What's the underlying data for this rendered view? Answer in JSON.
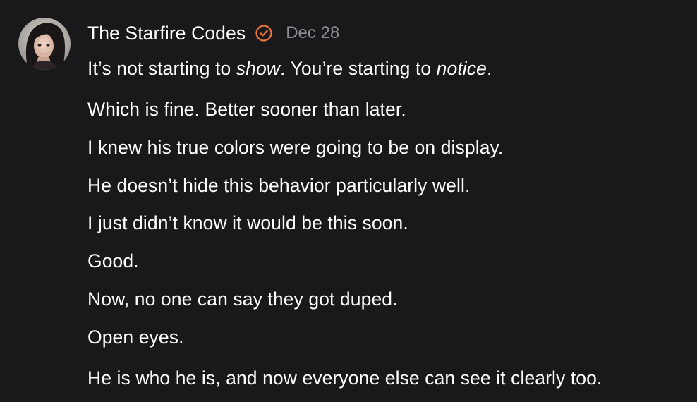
{
  "post": {
    "author": "The Starfire Codes",
    "date": "Dec 28",
    "verified_icon": "verified-badge-icon",
    "accent_color": "#e8743b",
    "first_line": {
      "part1": "It’s not starting to ",
      "em1": "show",
      "part2": ". You’re starting to ",
      "em2": "notice",
      "part3": "."
    },
    "lines": [
      "Which is fine. Better sooner than later.",
      "I knew his true colors were going to be on display.",
      "He doesn’t hide this behavior particularly well.",
      "I just didn’t know it would be this soon.",
      "Good.",
      "Now, no one can say they got duped.",
      "Open eyes.",
      "He is who he is, and now everyone else can see it clearly too."
    ]
  }
}
